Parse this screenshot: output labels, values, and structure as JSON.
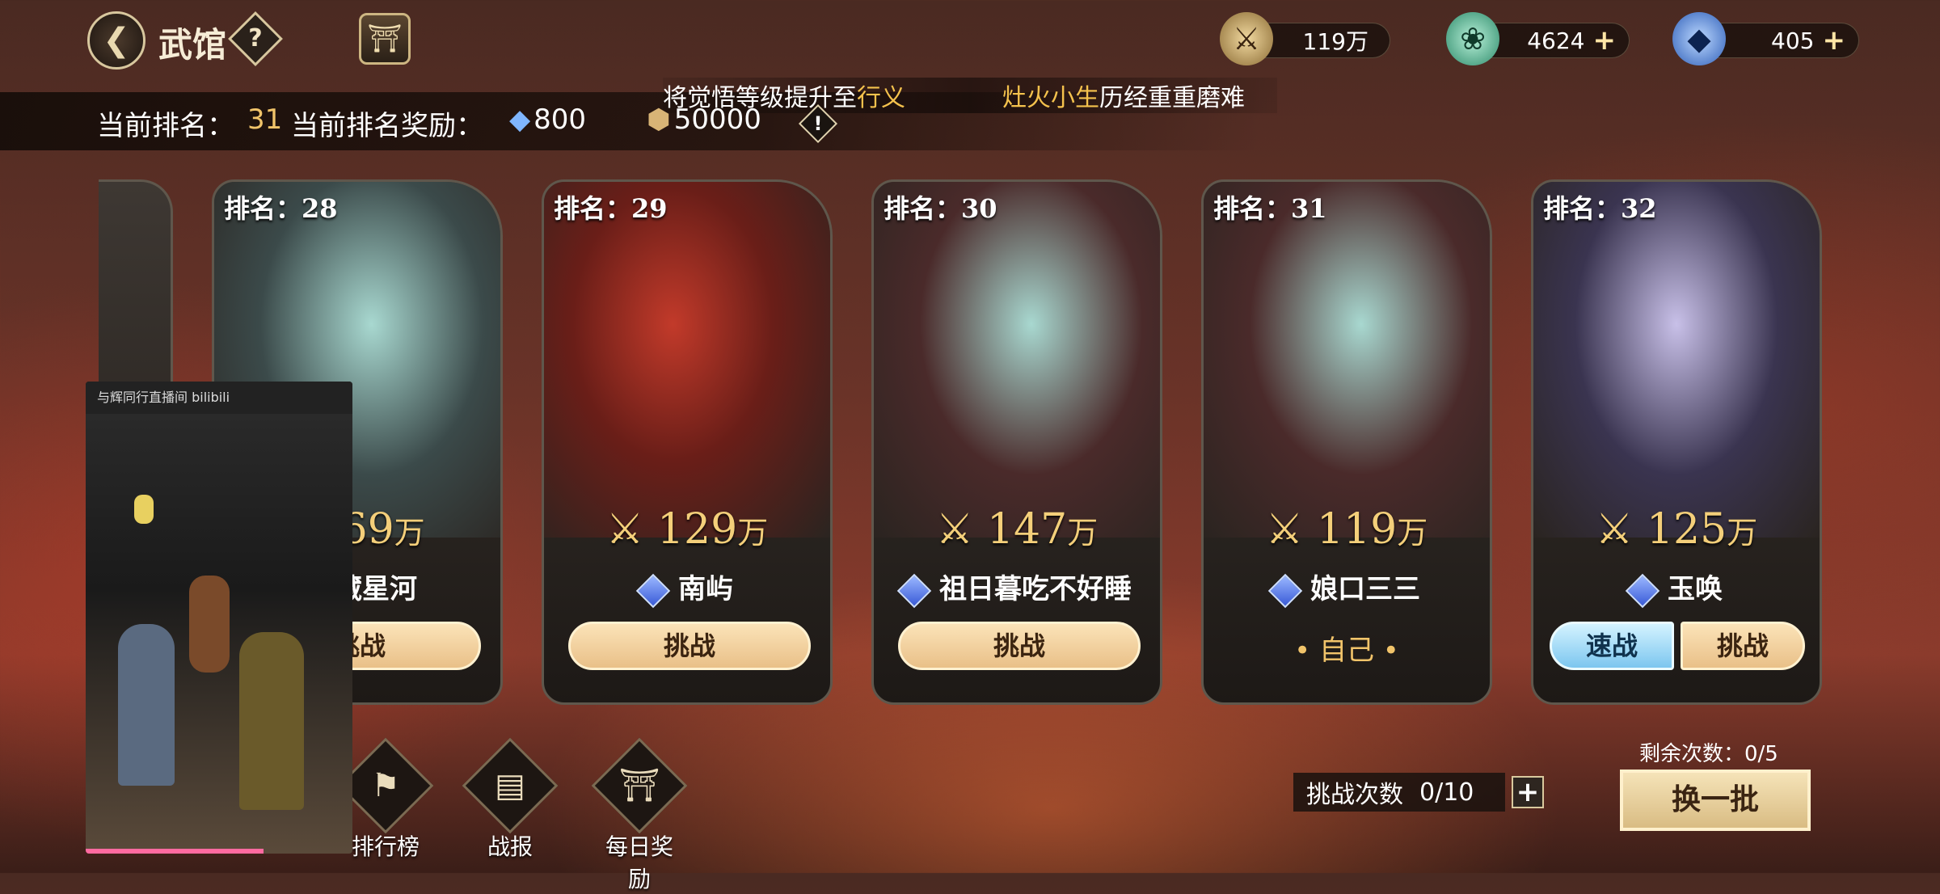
{
  "header": {
    "title": "武馆",
    "help": "?",
    "resources": [
      {
        "icon": "power-icon",
        "value": "119万"
      },
      {
        "icon": "jade-icon",
        "value": "4624"
      },
      {
        "icon": "crystal-icon",
        "value": "405"
      }
    ]
  },
  "rank_info": {
    "current_rank_label": "当前排名：",
    "current_rank_value": "31",
    "reward_label": "当前排名奖励：",
    "reward_crystal": "800",
    "reward_coin": "50000"
  },
  "marquee": {
    "part1": "将觉悟等级提升至",
    "hl1": "行义",
    "hl2": "灶火小生",
    "part2": "历经重重磨难"
  },
  "cards": [
    {
      "rank": "排名：28",
      "power": "69",
      "unit": "万",
      "name": "藏星河",
      "action": "挑战"
    },
    {
      "rank": "排名：29",
      "power": "129",
      "unit": "万",
      "name": "南屿",
      "action": "挑战"
    },
    {
      "rank": "排名：30",
      "power": "147",
      "unit": "万",
      "name": "祖日暮吃不好睡",
      "action": "挑战"
    },
    {
      "rank": "排名：31",
      "power": "119",
      "unit": "万",
      "name": "娘口三三",
      "self_label": "• 自己 •"
    },
    {
      "rank": "排名：32",
      "power": "125",
      "unit": "万",
      "name": "玉唤",
      "quick": "速战",
      "action": "挑战"
    }
  ],
  "bottom": {
    "leaderboard": "排行榜",
    "battle_report": "战报",
    "daily_reward": "每日奖励",
    "tries_label": "挑战次数",
    "tries_value": "0/10",
    "remaining": "剩余次数：0/5",
    "refresh": "换一批"
  },
  "live_overlay": {
    "header": "与辉同行直播间 bilibili"
  }
}
